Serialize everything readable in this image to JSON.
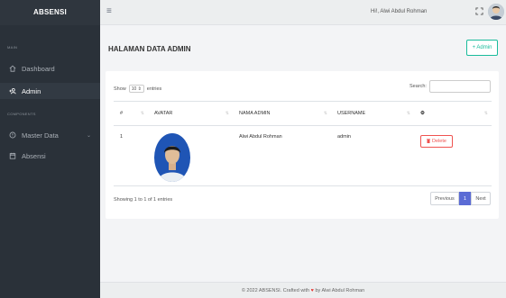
{
  "app": {
    "brand": "ABSENSI"
  },
  "sidebar": {
    "section_main": "MAIN",
    "section_components": "COMPONENTS",
    "items": [
      {
        "label": "Dashboard",
        "icon": "home-icon"
      },
      {
        "label": "Admin",
        "icon": "user-add-icon",
        "active": true
      },
      {
        "label": "Master Data",
        "icon": "layers-icon",
        "has_submenu": true
      },
      {
        "label": "Absensi",
        "icon": "calendar-icon"
      }
    ]
  },
  "topbar": {
    "greeting": "Hi!, Alwi Abdul Rohman",
    "menu_icon": "hamburger-icon",
    "fullscreen_icon": "fullscreen-icon"
  },
  "page": {
    "title": "HALAMAN DATA ADMIN",
    "add_button": "+ Admin"
  },
  "table": {
    "show_label": "Show",
    "length_value": "10",
    "entries_label": "entries",
    "search_label": "Search:",
    "headers": [
      "#",
      "AVATAR",
      "NAMA ADMIN",
      "USERNAME",
      "⚙"
    ],
    "rows": [
      {
        "no": "1",
        "name": "Alwi Abdul Rohman",
        "username": "admin",
        "action": "Delete"
      }
    ],
    "info": "Showing 1 to 1 of 1 entries",
    "pagination": {
      "previous": "Previous",
      "current": "1",
      "next": "Next"
    }
  },
  "footer": {
    "text_before": "© 2022 ABSENSI. Crafted with",
    "text_after": "by Alwi Abdul Rohman"
  },
  "colors": {
    "sidebar_bg": "#2a3139",
    "accent": "#1abc9c",
    "danger": "#ef5350",
    "page_active": "#5b6bd5"
  }
}
